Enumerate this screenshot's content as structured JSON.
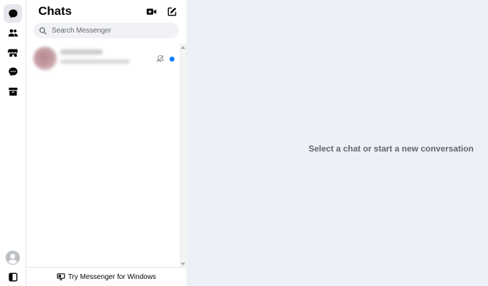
{
  "header": {
    "title": "Chats"
  },
  "search": {
    "placeholder": "Search Messenger",
    "value": ""
  },
  "conversations": [
    {
      "name": "",
      "preview": "",
      "muted": true,
      "unread": true
    }
  ],
  "footer": {
    "label": "Try Messenger for Windows"
  },
  "main": {
    "empty_message": "Select a chat or start a new conversation"
  },
  "rail": {
    "items": [
      {
        "id": "chats",
        "icon": "chat-bubble-icon",
        "active": true
      },
      {
        "id": "people",
        "icon": "people-icon",
        "active": false
      },
      {
        "id": "marketplace",
        "icon": "store-icon",
        "active": false
      },
      {
        "id": "requests",
        "icon": "message-requests-icon",
        "active": false
      },
      {
        "id": "archive",
        "icon": "archive-icon",
        "active": false
      }
    ],
    "bottom": [
      {
        "id": "profile",
        "icon": "avatar-icon"
      },
      {
        "id": "toggle-sidebar",
        "icon": "sidebar-toggle-icon"
      }
    ]
  },
  "colors": {
    "main_background": "#eef0f8",
    "unread_dot": "#0a7cff",
    "icon": "#050505",
    "muted_text": "#65676b"
  }
}
